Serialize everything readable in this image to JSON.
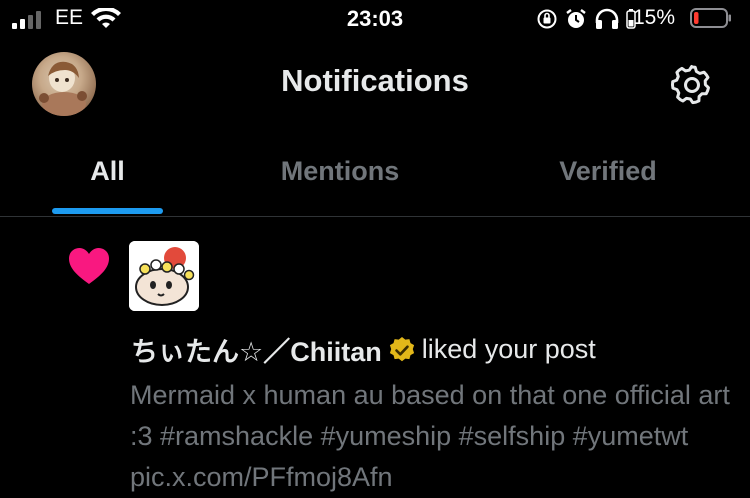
{
  "status_bar": {
    "carrier": "EE",
    "time": "23:03",
    "battery_percent": "15%",
    "battery_level": 0.15,
    "battery_color": "#ff3b30"
  },
  "header": {
    "title": "Notifications",
    "avatar_icon": "profile-avatar",
    "settings_icon": "gear-icon"
  },
  "tabs": [
    {
      "label": "All",
      "active": true
    },
    {
      "label": "Mentions",
      "active": false
    },
    {
      "label": "Verified",
      "active": false
    }
  ],
  "accent_color": "#1d9bf0",
  "notification": {
    "type_icon": "heart-icon",
    "type_color": "#f91880",
    "liker_name": "ちぃたん☆／Chiitan",
    "verified_badge_color": "#e2b719",
    "action_text": "liked your post",
    "post_text": "Mermaid x human au based on that one official art :3 #ramshackle #yumeship #selfship #yumetwt pic.x.com/PFfmoj8Afn"
  }
}
